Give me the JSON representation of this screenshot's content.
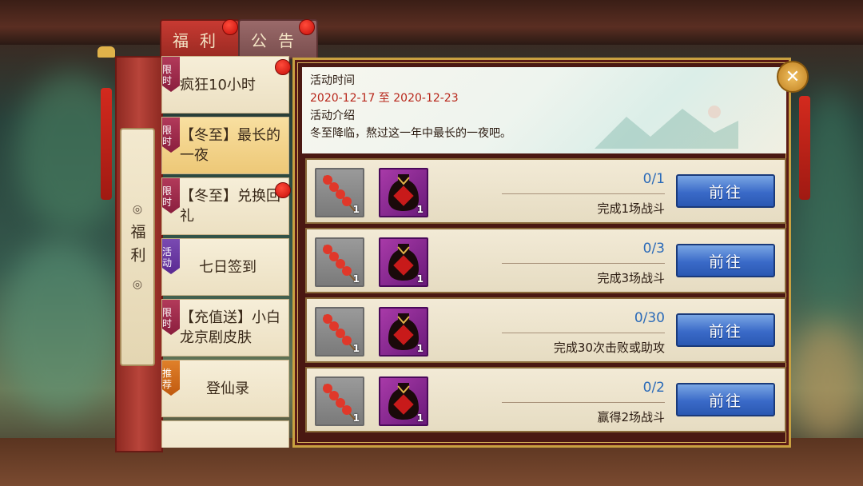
{
  "tabs": [
    {
      "label": "福利",
      "active": true,
      "has_dot": true
    },
    {
      "label": "公告",
      "active": false,
      "has_dot": true
    }
  ],
  "category_scroll": {
    "label": "福利"
  },
  "side_list": [
    {
      "badge": "限时",
      "badge_type": "limited",
      "label": "疯狂10小时",
      "has_dot": true,
      "active": false
    },
    {
      "badge": "限时",
      "badge_type": "limited",
      "label": "【冬至】最长的一夜",
      "has_dot": false,
      "active": true
    },
    {
      "badge": "限时",
      "badge_type": "limited",
      "label": "【冬至】兑换回礼",
      "has_dot": true,
      "active": false
    },
    {
      "badge": "活动",
      "badge_type": "activity",
      "label": "七日签到",
      "has_dot": false,
      "active": false
    },
    {
      "badge": "限时",
      "badge_type": "limited",
      "label": "【充值送】小白龙京剧皮肤",
      "has_dot": false,
      "active": false
    },
    {
      "badge": "推荐",
      "badge_type": "recommend",
      "label": "登仙录",
      "has_dot": false,
      "active": false
    }
  ],
  "event_info": {
    "time_label": "活动时间",
    "time_value": "2020-12-17 至 2020-12-23",
    "intro_label": "活动介绍",
    "intro_text": "冬至降临，熬过这一年中最长的一夜吧。"
  },
  "tasks": [
    {
      "progress": "0/1",
      "description": "完成1场战斗",
      "button": "前往",
      "rewards": [
        {
          "icon": "candied-haws-icon",
          "count": "1"
        },
        {
          "icon": "wine-jar-icon",
          "count": "1"
        }
      ]
    },
    {
      "progress": "0/3",
      "description": "完成3场战斗",
      "button": "前往",
      "rewards": [
        {
          "icon": "candied-haws-icon",
          "count": "1"
        },
        {
          "icon": "wine-jar-icon",
          "count": "1"
        }
      ]
    },
    {
      "progress": "0/30",
      "description": "完成30次击败或助攻",
      "button": "前往",
      "rewards": [
        {
          "icon": "candied-haws-icon",
          "count": "1"
        },
        {
          "icon": "wine-jar-icon",
          "count": "1"
        }
      ]
    },
    {
      "progress": "0/2",
      "description": "赢得2场战斗",
      "button": "前往",
      "rewards": [
        {
          "icon": "candied-haws-icon",
          "count": "1"
        },
        {
          "icon": "wine-jar-icon",
          "count": "1"
        }
      ]
    }
  ],
  "colors": {
    "accent_red": "#b8261a",
    "progress_blue": "#2a6ab8",
    "button_blue": "#3a6ac8",
    "gold_frame": "#c9a040"
  }
}
